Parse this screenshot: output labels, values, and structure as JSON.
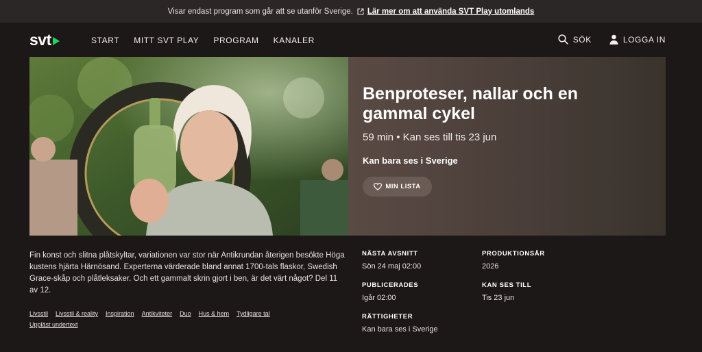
{
  "banner": {
    "text": "Visar endast program som går att se utanför Sverige.",
    "link": "Lär mer om att använda SVT Play utomlands"
  },
  "nav": {
    "logo": "svt",
    "links": [
      "START",
      "MITT SVT PLAY",
      "PROGRAM",
      "KANALER"
    ],
    "search": "SÖK",
    "login": "LOGGA IN"
  },
  "hero": {
    "title": "Benproteser, nallar och en gammal cykel",
    "meta": "59 min • Kan ses till tis 23 jun",
    "restriction": "Kan bara ses i Sverige",
    "my_list": "MIN LISTA"
  },
  "description": "Fin konst och slitna plåtskyltar, variationen var stor när Antikrundan återigen besökte Höga kustens hjärta Härnösand. Experterna värderade bland annat 1700-tals flaskor, Swedish Grace-skåp och plåtleksaker. Och ett gammalt skrin gjort i ben, är det värt något? Del 11 av 12.",
  "tags": [
    "Livsstil",
    "Livsstil & reality",
    "Inspiration",
    "Antikviteter",
    "Duo",
    "Hus & hem",
    "Tydligare tal",
    "Uppläst undertext"
  ],
  "facts_left": [
    {
      "label": "NÄSTA AVSNITT",
      "value": "Sön 24 maj 02:00"
    },
    {
      "label": "PUBLICERADES",
      "value": "Igår 02:00"
    },
    {
      "label": "RÄTTIGHETER",
      "value": "Kan bara ses i Sverige"
    }
  ],
  "facts_right": [
    {
      "label": "PRODUKTIONSÅR",
      "value": "2026"
    },
    {
      "label": "KAN SES TILL",
      "value": "Tis 23 jun"
    }
  ],
  "colors": {
    "background": "#1c1817",
    "banner": "#2b2726",
    "accent": "#1bd75e",
    "hero_panel": "#4a3e39"
  }
}
